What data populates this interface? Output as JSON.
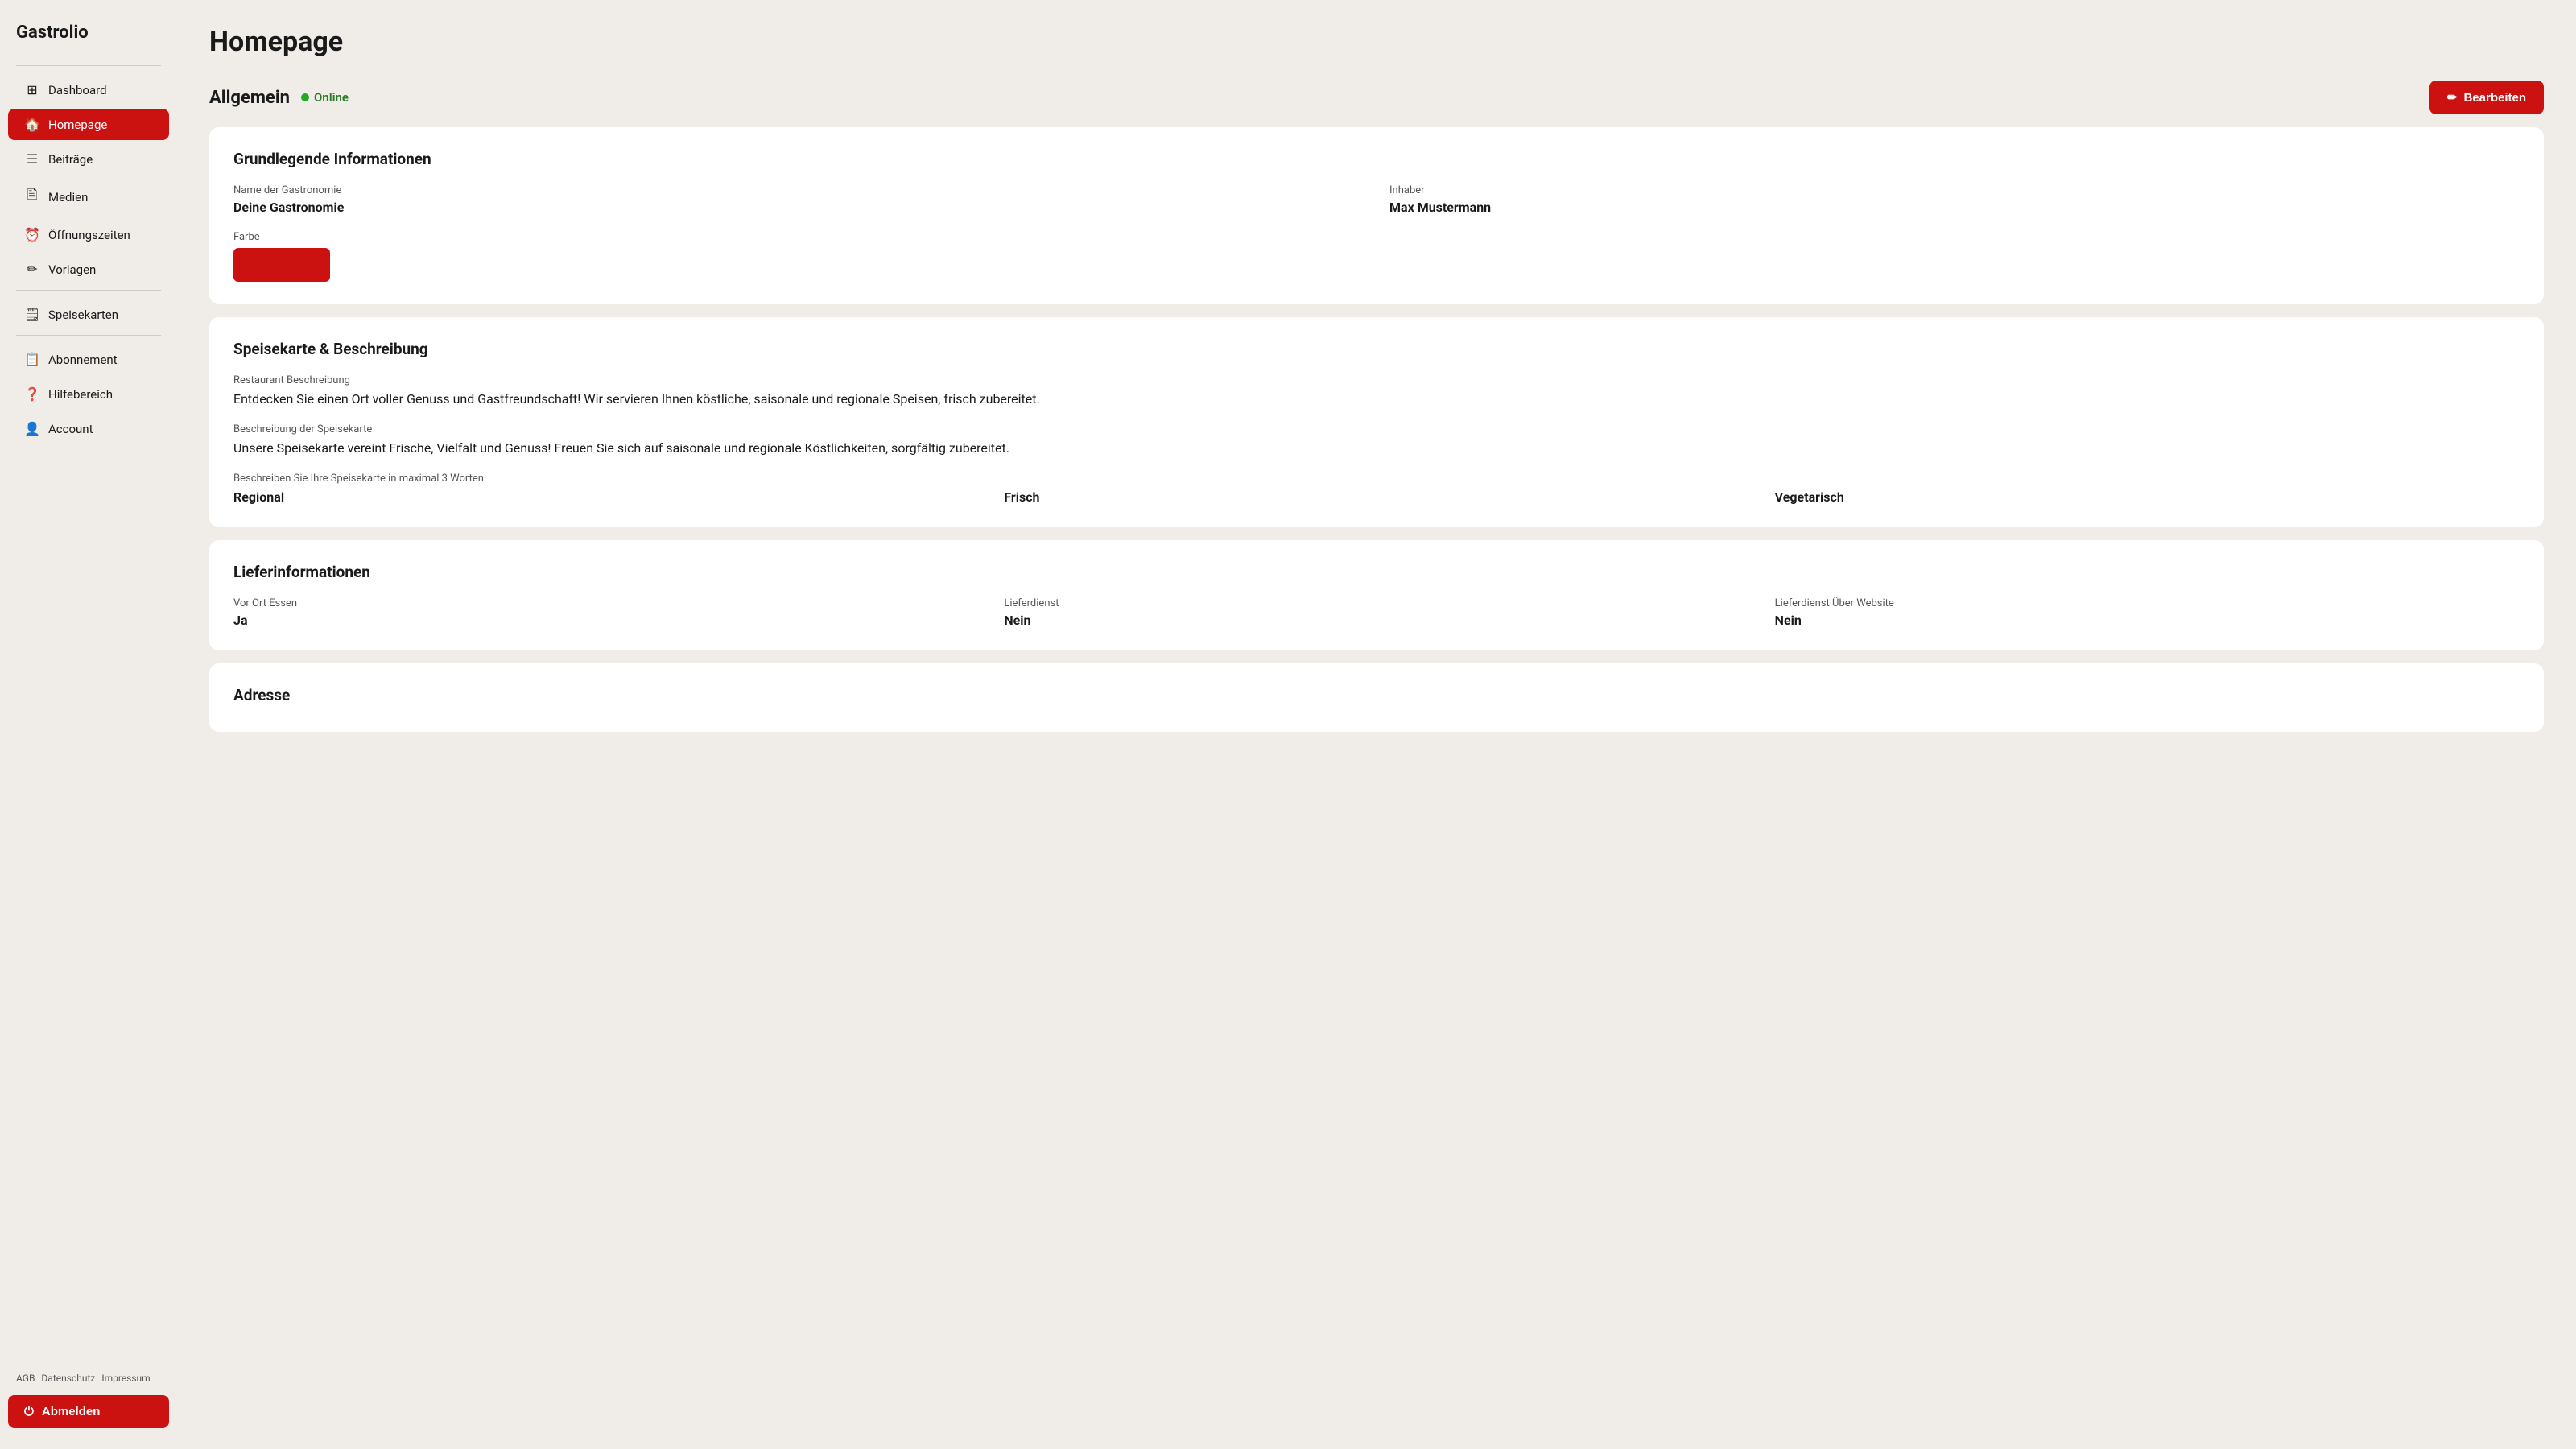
{
  "app": {
    "name": "Gastrolio"
  },
  "sidebar": {
    "items": [
      {
        "id": "dashboard",
        "label": "Dashboard",
        "icon": "⊞",
        "active": false
      },
      {
        "id": "homepage",
        "label": "Homepage",
        "icon": "🏠",
        "active": true
      },
      {
        "id": "beitraege",
        "label": "Beiträge",
        "icon": "☰",
        "active": false
      },
      {
        "id": "medien",
        "label": "Medien",
        "icon": "🖹",
        "active": false
      },
      {
        "id": "oeffnungszeiten",
        "label": "Öffnungszeiten",
        "icon": "⏰",
        "active": false
      },
      {
        "id": "vorlagen",
        "label": "Vorlagen",
        "icon": "✏️",
        "active": false
      },
      {
        "id": "speisekarten",
        "label": "Speisekarten",
        "icon": "🗒",
        "active": false
      },
      {
        "id": "abonnement",
        "label": "Abonnement",
        "icon": "📋",
        "active": false
      },
      {
        "id": "hilfebereich",
        "label": "Hilfebereich",
        "icon": "❓",
        "active": false
      },
      {
        "id": "account",
        "label": "Account",
        "icon": "👤",
        "active": false
      }
    ],
    "footer": {
      "links": [
        "AGB",
        "Datenschutz",
        "Impressum"
      ],
      "logout_label": "Abmelden"
    }
  },
  "page": {
    "title": "Homepage"
  },
  "main": {
    "section_header": {
      "title": "Allgemein",
      "status": "Online",
      "edit_button": "Bearbeiten"
    },
    "cards": [
      {
        "id": "grundlegende",
        "title": "Grundlegende Informationen",
        "fields": [
          {
            "label": "Name der Gastronomie",
            "value": "Deine Gastronomie"
          },
          {
            "label": "Inhaber",
            "value": "Max Mustermann"
          },
          {
            "label": "Farbe",
            "value": "",
            "type": "color",
            "color": "#cc1111"
          }
        ]
      },
      {
        "id": "speisekarte",
        "title": "Speisekarte & Beschreibung",
        "fields": [
          {
            "label": "Restaurant Beschreibung",
            "value": "Entdecken Sie einen Ort voller Genuss und Gastfreundschaft! Wir servieren Ihnen köstliche, saisonale und regionale Speisen, frisch zubereitet."
          },
          {
            "label": "Beschreibung der Speisekarte",
            "value": "Unsere Speisekarte vereint Frische, Vielfalt und Genuss! Freuen Sie sich auf saisonale und regionale Köstlichkeiten, sorgfältig zubereitet."
          },
          {
            "label": "Beschreiben Sie Ihre Speisekarte in maximal 3 Worten",
            "words": [
              "Regional",
              "Frisch",
              "Vegetarisch"
            ]
          }
        ]
      },
      {
        "id": "lieferinfo",
        "title": "Lieferinformationen",
        "fields": [
          {
            "label": "Vor Ort Essen",
            "value": "Ja"
          },
          {
            "label": "Lieferdienst",
            "value": "Nein"
          },
          {
            "label": "Lieferdienst Über Website",
            "value": "Nein"
          }
        ]
      },
      {
        "id": "adresse",
        "title": "Adresse",
        "fields": []
      }
    ]
  }
}
